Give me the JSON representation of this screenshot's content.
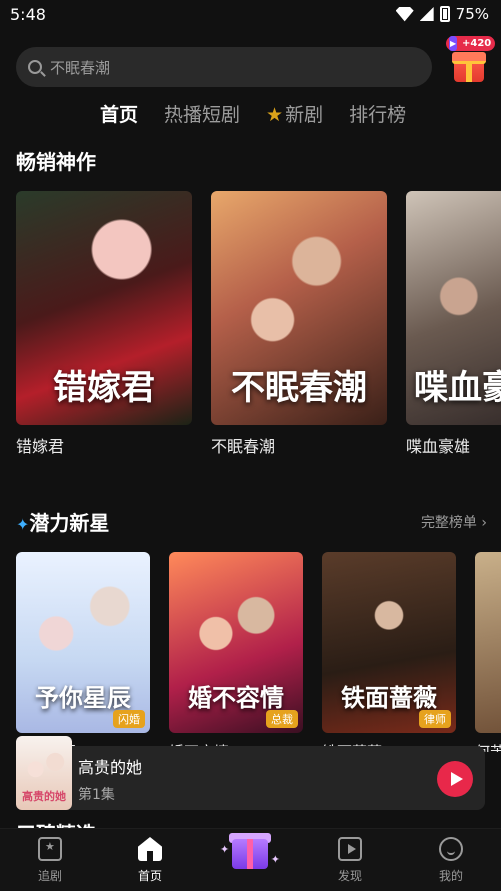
{
  "status_bar": {
    "time": "5:48",
    "battery": "75%"
  },
  "search": {
    "placeholder": "不眠春潮"
  },
  "gift_badge": "+420",
  "tabs": [
    {
      "label": "首页",
      "active": true
    },
    {
      "label": "热播短剧",
      "active": false
    },
    {
      "label": "新剧",
      "active": false,
      "icon": "star-icon"
    },
    {
      "label": "排行榜",
      "active": false
    }
  ],
  "bestsellers": {
    "title": "畅销神作",
    "items": [
      {
        "name": "错嫁君",
        "poster_text": "错嫁君"
      },
      {
        "name": "不眠春潮",
        "poster_text": "不眠春潮"
      },
      {
        "name": "喋血豪雄",
        "poster_text": "喋血豪"
      }
    ]
  },
  "rising": {
    "title": "潜力新星",
    "more": "完整榜单",
    "items": [
      {
        "name": "予你星辰",
        "poster_text": "予你星辰",
        "tag": "闪婚"
      },
      {
        "name": "婚不容情",
        "poster_text": "婚不容情",
        "tag": "总裁"
      },
      {
        "name": "铁面蔷薇",
        "poster_text": "铁面蔷薇",
        "tag": "律师"
      },
      {
        "name": "何苦",
        "poster_text": "",
        "tag": ""
      }
    ]
  },
  "player": {
    "title": "高贵的她",
    "episode": "第1集",
    "thumb_text": "高贵的她"
  },
  "next_section_title": "口碑精选",
  "nav": [
    {
      "label": "追剧",
      "icon": "follow-icon"
    },
    {
      "label": "首页",
      "icon": "home-icon",
      "active": true
    },
    {
      "label": "",
      "icon": "gift-icon"
    },
    {
      "label": "发现",
      "icon": "discover-icon"
    },
    {
      "label": "我的",
      "icon": "profile-icon"
    }
  ],
  "colors": {
    "background": "#111111",
    "accent_red": "#e8284a",
    "tag_orange": "#e6a21d"
  }
}
